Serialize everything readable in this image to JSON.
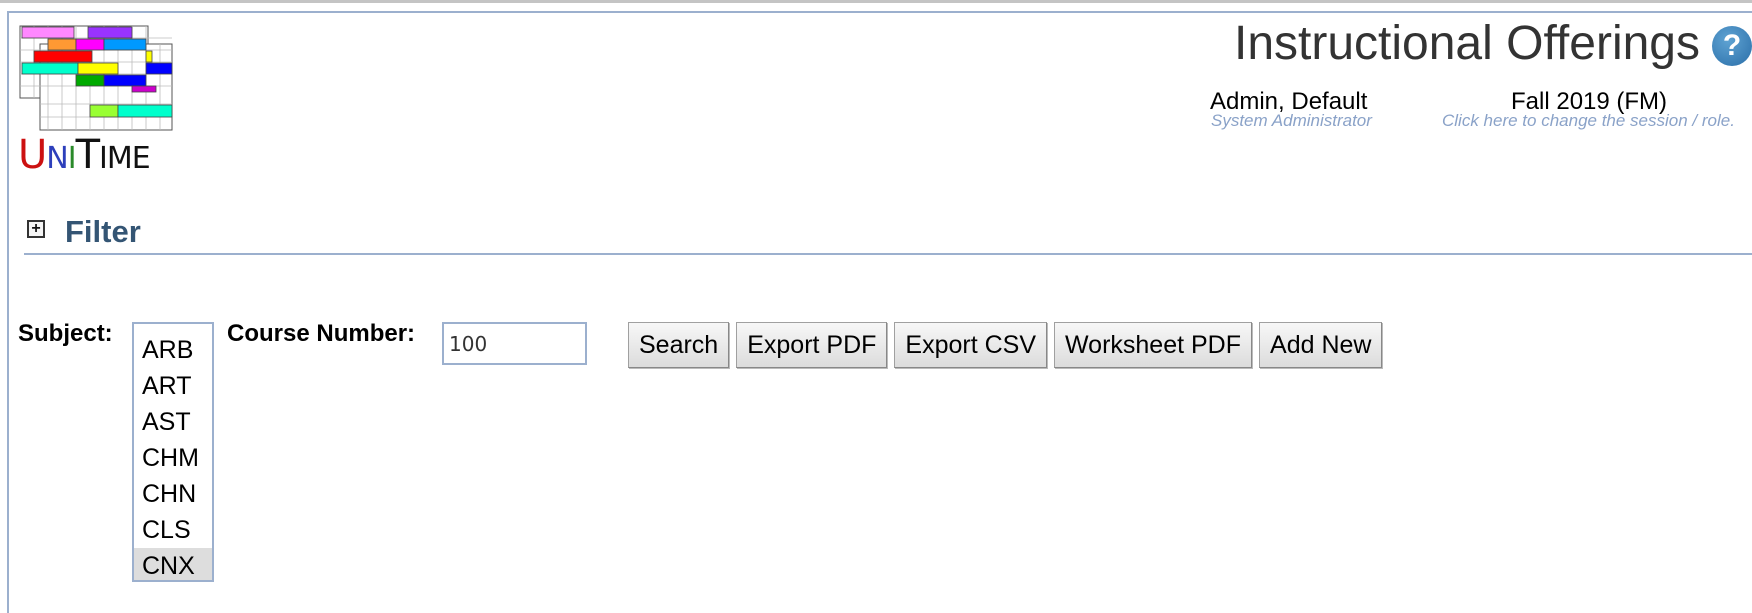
{
  "app": {
    "name": "UniTime",
    "logo_text": {
      "u": "U",
      "n": "N",
      "i": "I",
      "t": "T",
      "ime": "IME"
    }
  },
  "header": {
    "title": "Instructional Offerings",
    "help_icon": "question-mark-icon",
    "user": {
      "name": "Admin, Default",
      "role": "System Administrator"
    },
    "session": {
      "name": "Fall 2019 (FM)",
      "hint": "Click here to change the session / role."
    }
  },
  "filter": {
    "title": "Filter",
    "toggle_symbol": "+",
    "subject_label": "Subject:",
    "subjects": [
      "ARB",
      "ART",
      "AST",
      "CHM",
      "CHN",
      "CLS",
      "CNX"
    ],
    "selected_subject": "CNX",
    "course_number_label": "Course Number:",
    "course_number_value": "100"
  },
  "buttons": {
    "search": "Search",
    "export_pdf": "Export PDF",
    "export_csv": "Export CSV",
    "worksheet_pdf": "Worksheet PDF",
    "add_new": "Add New"
  },
  "colors": {
    "accent_border": "#9cb0ce",
    "filter_title": "#345574",
    "hint_text": "#8aa2c8",
    "selected_option_bg": "#dddddd"
  }
}
